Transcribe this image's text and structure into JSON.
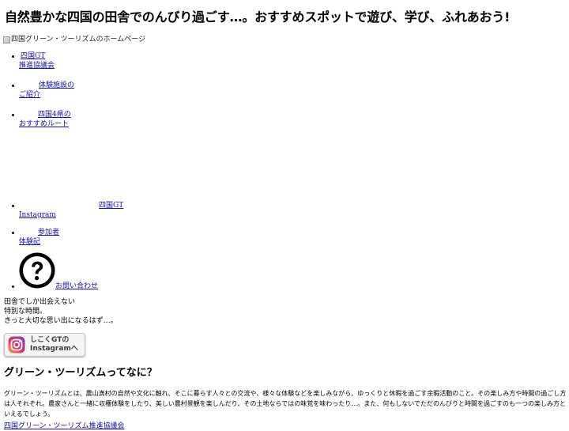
{
  "header": {
    "title": "自然豊かな四国の田舎でのんびり過ごす…。おすすめスポットで遊び、学び、ふれあおう!"
  },
  "logo": {
    "alt": "四国グリーン・ツーリズムのホームページ"
  },
  "nav": {
    "items": [
      {
        "line1": "四国GT",
        "line2": "推進協議会"
      },
      {
        "line1": "体験施設の",
        "line2": "ご紹介"
      },
      {
        "line1": "四国4県の",
        "line2": "おすすめルート"
      },
      {
        "line1": "四国GT",
        "line2": "Instagram"
      },
      {
        "line1": "参加者",
        "line2": "体験記"
      },
      {
        "line1": "お問い合わせ"
      }
    ]
  },
  "tagline": {
    "lines": [
      "田舎でしか出会えない",
      "特別な時間。",
      "きっと大切な思い出になるはず…。"
    ]
  },
  "instagram_button": {
    "line1": "しこくGTの",
    "line2": "Instagramへ"
  },
  "section": {
    "title": "グリーン・ツーリズムってなに？",
    "body": "グリーン・ツーリズムとは、農山漁村の自然や文化に触れ、そこに暮らす人々との交流や、様々な体験などを楽しみながら、ゆっくりと休暇を過ごす余暇活動のこと。その楽しみ方や時間の過ごし方は人それぞれ。農家さんと一緒に収穫体験をしたり、美しい農村景観を楽しんだり、その土地ならではの味覚を味わったり…。また、何もしないでただのんびりと時間を過ごすのも一つの楽しみ方といえるでしょう。"
  },
  "footer": {
    "link": "四国グリーン・ツーリズム推進協議会"
  },
  "colors": {
    "link": "#1a0dab",
    "text": "#000000"
  }
}
